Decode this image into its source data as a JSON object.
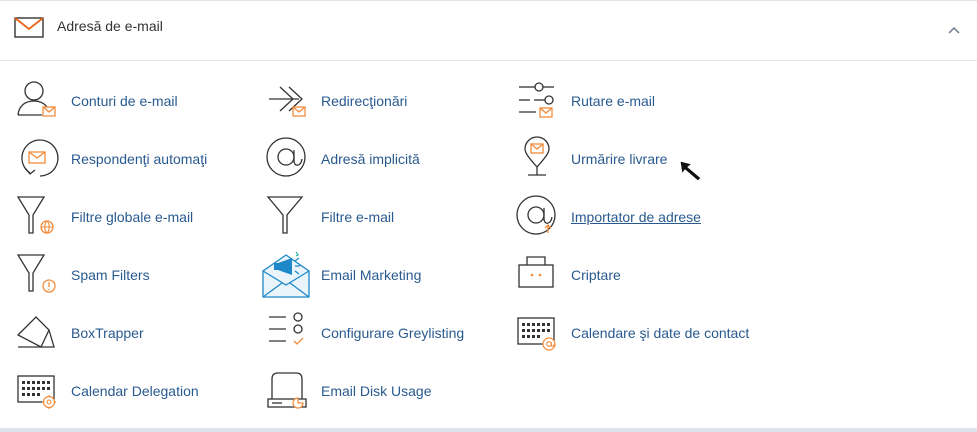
{
  "section": {
    "title": "Adresă de e-mail",
    "icon": "envelope-icon",
    "collapse_icon": "chevron-up-icon"
  },
  "items": [
    {
      "label": "Conturi de e-mail",
      "icon": "email-accounts-icon"
    },
    {
      "label": "Redirecţionări",
      "icon": "forwarders-icon"
    },
    {
      "label": "Rutare e-mail",
      "icon": "email-routing-icon"
    },
    {
      "label": "Respondenţi automaţi",
      "icon": "autoresponders-icon"
    },
    {
      "label": "Adresă implicită",
      "icon": "default-address-icon"
    },
    {
      "label": "Urmărire livrare",
      "icon": "track-delivery-icon"
    },
    {
      "label": "Filtre globale e-mail",
      "icon": "global-filters-icon"
    },
    {
      "label": "Filtre e-mail",
      "icon": "email-filters-icon"
    },
    {
      "label": "Importator de adrese",
      "icon": "address-importer-icon"
    },
    {
      "label": "Spam Filters",
      "icon": "spam-filters-icon"
    },
    {
      "label": "Email Marketing",
      "icon": "email-marketing-icon"
    },
    {
      "label": "Criptare",
      "icon": "encryption-icon"
    },
    {
      "label": "BoxTrapper",
      "icon": "boxtrapper-icon"
    },
    {
      "label": "Configurare Greylisting",
      "icon": "greylisting-icon"
    },
    {
      "label": "Calendare şi date de contact",
      "icon": "calendars-contacts-icon"
    },
    {
      "label": "Calendar Delegation",
      "icon": "calendar-delegation-icon"
    },
    {
      "label": "Email Disk Usage",
      "icon": "email-disk-usage-icon"
    }
  ],
  "colors": {
    "link": "#295a8f",
    "icon_stroke": "#333333",
    "accent": "#f28b3b",
    "marketing_blue": "#1e88c9"
  }
}
